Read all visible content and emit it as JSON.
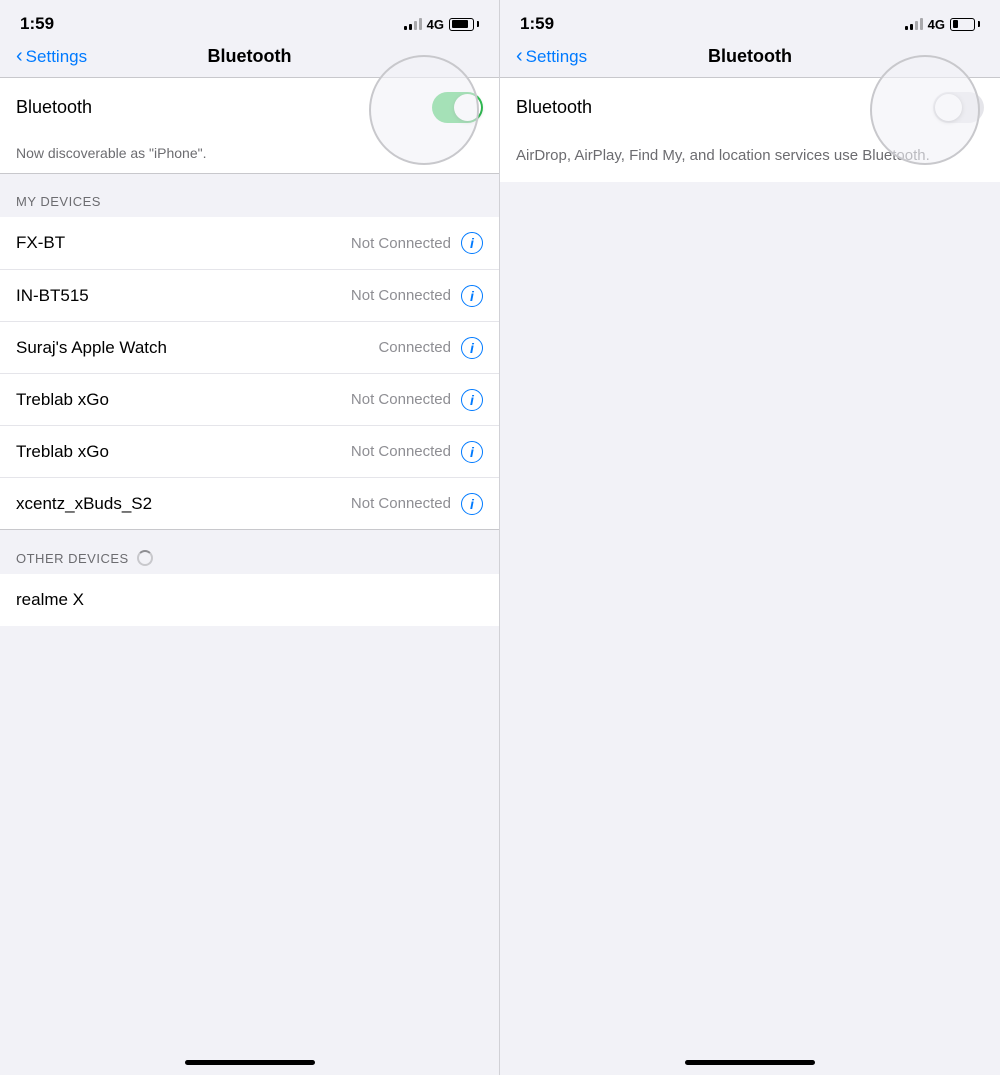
{
  "left": {
    "statusBar": {
      "time": "1:59",
      "network": "4G",
      "batteryPercent": 80
    },
    "nav": {
      "backLabel": "Settings",
      "title": "Bluetooth"
    },
    "toggle": {
      "label": "Bluetooth",
      "isOn": true
    },
    "subtitle": "Now discoverable as \"iPhone\".",
    "myDevicesHeader": "MY DEVICES",
    "devices": [
      {
        "name": "FX-BT",
        "status": "Not Connected",
        "connected": false
      },
      {
        "name": "IN-BT515",
        "status": "Not Connected",
        "connected": false
      },
      {
        "name": "Suraj's Apple Watch",
        "status": "Connected",
        "connected": true
      },
      {
        "name": "Treblab xGo",
        "status": "Not Connected",
        "connected": false
      },
      {
        "name": "Treblab xGo",
        "status": "Not Connected",
        "connected": false
      },
      {
        "name": "xcentz_xBuds_S2",
        "status": "Not Connected",
        "connected": false
      }
    ],
    "otherDevicesHeader": "OTHER DEVICES",
    "otherDevices": [
      {
        "name": "realme X"
      }
    ],
    "infoIcon": "i"
  },
  "right": {
    "statusBar": {
      "time": "1:59",
      "network": "4G"
    },
    "nav": {
      "backLabel": "Settings",
      "title": "Bluetooth"
    },
    "toggle": {
      "label": "Bluetooth",
      "isOn": false
    },
    "subtitle": "AirDrop, AirPlay, Find My, and location services use Bluetooth."
  }
}
